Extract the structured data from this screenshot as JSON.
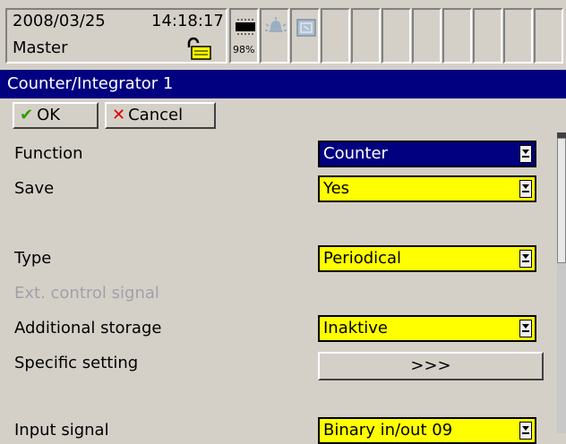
{
  "status": {
    "date": "2008/03/25",
    "time": "14:18:17",
    "user": "Master",
    "memory_percent": "98%"
  },
  "title": "Counter/Integrator 1",
  "buttons": {
    "ok": "OK",
    "cancel": "Cancel"
  },
  "fields": [
    {
      "label": "Function",
      "value": "Counter"
    },
    {
      "label": "Save",
      "value": "Yes"
    },
    {
      "label": "Type",
      "value": "Periodical"
    },
    {
      "label": "Ext. control signal"
    },
    {
      "label": "Additional storage",
      "value": "Inaktive"
    },
    {
      "label": "Specific setting",
      "value": ">>>"
    },
    {
      "label": "Input signal",
      "value": "Binary in/out 09"
    }
  ],
  "colors": {
    "titlebar": "#000080",
    "dropdown": "#ffff00",
    "selected_dropdown": "#000080",
    "window": "#d4d0c8"
  }
}
